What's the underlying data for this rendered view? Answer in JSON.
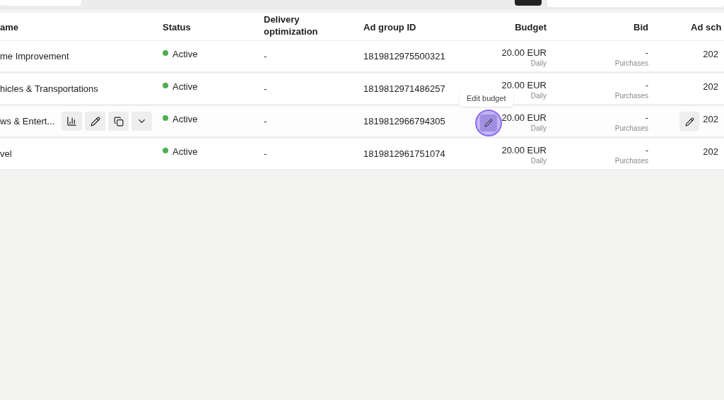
{
  "table": {
    "columns": [
      {
        "label": "ame"
      },
      {
        "label": "Status"
      },
      {
        "label": "Delivery optimization"
      },
      {
        "label": "Ad group ID"
      },
      {
        "label": "Budget"
      },
      {
        "label": "Bid"
      },
      {
        "label": "Ad sch"
      }
    ],
    "rows": [
      {
        "name": "me Improvement",
        "status": "Active",
        "delivery": "-",
        "id": "1819812975500321",
        "budget": "20.00 EUR",
        "budget_period": "Daily",
        "bid": "-",
        "bid_goal": "Purchases",
        "schedule": "202",
        "hovered": false
      },
      {
        "name": "hicles & Transportations",
        "status": "Active",
        "delivery": "-",
        "id": "1819812971486257",
        "budget": "20.00 EUR",
        "budget_period": "Daily",
        "bid": "-",
        "bid_goal": "Purchases",
        "schedule": "202",
        "hovered": false
      },
      {
        "name": "ws & Entert...",
        "status": "Active",
        "delivery": "-",
        "id": "1819812966794305",
        "budget": "20.00 EUR",
        "budget_period": "Daily",
        "bid": "-",
        "bid_goal": "Purchases",
        "schedule": "202",
        "hovered": true
      },
      {
        "name": "vel",
        "status": "Active",
        "delivery": "-",
        "id": "1819812961751074",
        "budget": "20.00 EUR",
        "budget_period": "Daily",
        "bid": "-",
        "bid_goal": "Purchases",
        "schedule": "202",
        "hovered": false
      }
    ]
  },
  "tooltip": {
    "text": "Edit budget"
  }
}
